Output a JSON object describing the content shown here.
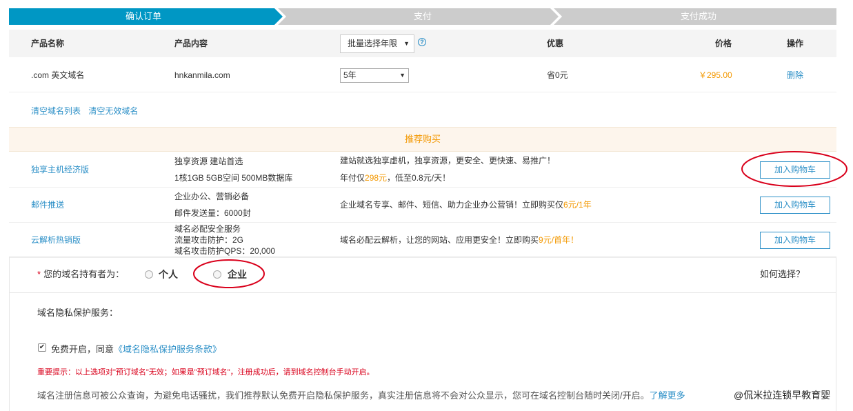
{
  "steps": {
    "step1": "确认订单",
    "step2": "支付",
    "step3": "支付成功"
  },
  "colors": {
    "active_step": "#0097c4",
    "inactive_step": "#cccccc",
    "link": "#2b8fc7",
    "price": "#f39800",
    "warning": "#d9001b",
    "annotation": "#d9001b"
  },
  "table": {
    "col_name": "产品名称",
    "col_content": "产品内容",
    "batch_select": "批量选择年限",
    "col_discount": "优惠",
    "col_price": "价格",
    "col_action": "操作",
    "row": {
      "name": ".com 英文域名",
      "content": "hnkanmila.com",
      "years": "5年",
      "discount": "省0元",
      "price": "￥295.00",
      "action": "删除"
    }
  },
  "links": {
    "clear_list": "清空域名列表",
    "clear_invalid": "清空无效域名"
  },
  "recommend": {
    "title": "推荐购买",
    "cart_label": "加入购物车",
    "items": [
      {
        "name": "独享主机经济版",
        "spec1": "独享资源 建站首选",
        "spec2": "1核1GB 5GB空间 500MB数据库",
        "spec3": "",
        "desc1": "建站就选独享虚机，独享资源，更安全、更快速、易推广！",
        "desc2a": "年付仅",
        "desc2hl": "298元",
        "desc2b": "，低至0.8元/天！"
      },
      {
        "name": "邮件推送",
        "spec1": "企业办公、营销必备",
        "spec2": "邮件发送量：6000封",
        "spec3": "",
        "desc1a": "企业域名专享、邮件、短信、助力企业办公营销！立即购买仅",
        "desc1hl": "6元/1年"
      },
      {
        "name": "云解析热销版",
        "spec1": "域名必配安全服务",
        "spec2": "流量攻击防护：2G",
        "spec3": "域名攻击防护QPS：20,000",
        "desc1a": "域名必配云解析，让您的网站、应用更安全！立即购买",
        "desc1hl": "9元/首年！"
      }
    ]
  },
  "owner": {
    "label": "您的域名持有者为：",
    "required_mark": "*",
    "opt_personal": "个人",
    "opt_company": "企业",
    "how": "如何选择？"
  },
  "privacy": {
    "title": "域名隐私保护服务：",
    "agree_text": "免费开启，同意",
    "agree_link": "《域名隐私保护服务条款》",
    "checkbox_mark": "✔",
    "warning": "重要提示：以上选项对\"预订域名\"无效；如果是\"预订域名\"，注册成功后，请到域名控制台手动开启。",
    "info": "域名注册信息可被公众查询，为避免电话骚扰，我们推荐默认免费开启隐私保护服务，真实注册信息将不会对公众显示，您可在域名控制台随时关闭/开启。",
    "learn_more": "了解更多"
  },
  "watermark": "@侃米拉连锁早教育婴"
}
